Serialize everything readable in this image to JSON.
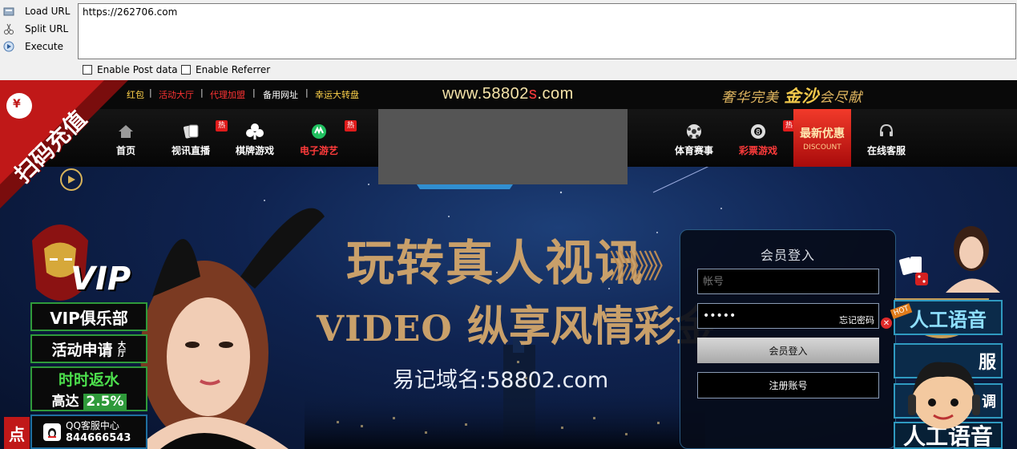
{
  "toolbar": {
    "load_url": "Load URL",
    "split_url": "Split URL",
    "execute": "Execute",
    "url_value": "https://262706.com",
    "enable_post": "Enable Post data",
    "enable_referrer": "Enable Referrer"
  },
  "site": {
    "top_links": [
      "红包",
      "活动大厅",
      "代理加盟",
      "备用网址",
      "幸运大转盘"
    ],
    "domain_main": "www.58802",
    "domain_accent": "s",
    "domain_tail": ".com",
    "slogan_pre": "奢华完美",
    "slogan_brand": "金沙",
    "slogan_post": "会尽献",
    "nav": {
      "home": "首页",
      "live": "视讯直播",
      "cards": "棋牌游戏",
      "egames": "电子游艺",
      "sports": "体育赛事",
      "lottery": "彩票游戏",
      "promo": "最新优惠",
      "promo_en": "DISCOUNT",
      "service": "在线客服"
    },
    "hot_badge": "热",
    "qr_promo": "扫码充值",
    "banner": {
      "title": "玩转真人视讯",
      "arrows": "》》》》》",
      "sub_en": "VIDEO",
      "sub_cn": "纵享风情彩金",
      "domain_hint": "易记域名:58802.com"
    },
    "left_side": {
      "vip_badge": "VIP",
      "club": "VIP俱乐部",
      "apply": "活动申请",
      "apply_tail": "大厅",
      "rebate_title": "时时返水",
      "rebate_prefix": "高达",
      "rebate_value": "2.5%",
      "qq_service": "QQ客服中心",
      "qq_number": "844666543",
      "bottom_char": "点"
    },
    "login": {
      "title": "会员登入",
      "account_placeholder": "帐号",
      "password_value": "•••••",
      "forgot": "忘记密码",
      "login_button": "会员登入",
      "register_button": "注册账号"
    },
    "right_side": {
      "ai_voice": "人工语音",
      "hot_tag": "HOT",
      "service_partial": "服",
      "service_partial2": "调",
      "bottom_voice": "人工语音"
    }
  }
}
